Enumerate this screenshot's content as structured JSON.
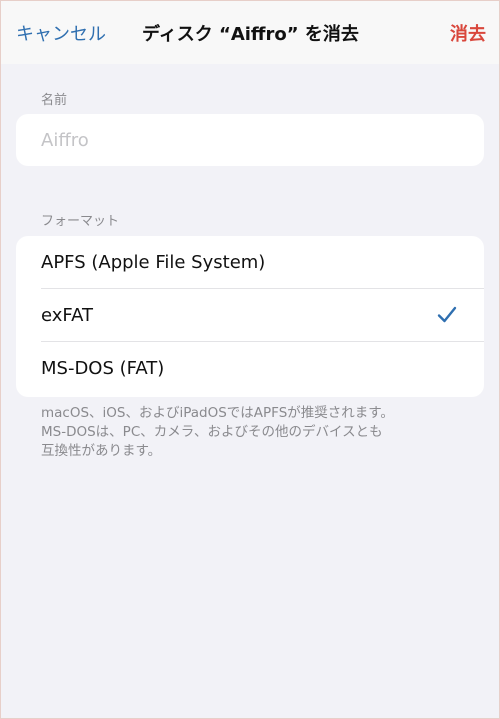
{
  "navbar": {
    "cancel_label": "キャンセル",
    "title": "ディスク “Aiffro” を消去",
    "erase_label": "消去"
  },
  "name_section": {
    "label": "名前",
    "placeholder": "Aiffro",
    "value": ""
  },
  "format_section": {
    "label": "フォーマット",
    "options": [
      {
        "label": "APFS (Apple File System)",
        "selected": false
      },
      {
        "label": "exFAT",
        "selected": true
      },
      {
        "label": "MS-DOS (FAT)",
        "selected": false
      }
    ]
  },
  "footer": {
    "lines": [
      "macOS、iOS、およびiPadOSではAPFSが推奨されます。",
      "MS-DOSは、PC、カメラ、およびその他のデバイスとも",
      "互換性があります。"
    ]
  },
  "colors": {
    "accent_blue": "#2f6fb0",
    "destructive_red": "#d9473c",
    "background": "#f2f2f7"
  },
  "icons": {
    "selected_mark": "checkmark-icon"
  }
}
